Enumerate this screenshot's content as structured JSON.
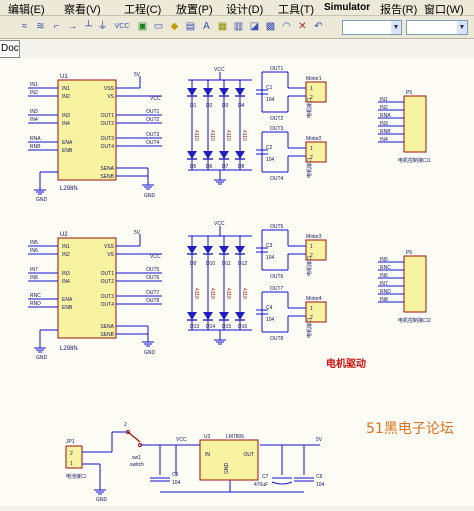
{
  "menu": [
    "编辑(E)",
    "察看(V)",
    "工程(C)",
    "放置(P)",
    "设计(D)",
    "工具(T)",
    "Simulator",
    "报告(R)",
    "窗口(W)"
  ],
  "doc_tab": "Doc",
  "toolbar_icons": [
    "wire-tool-icon",
    "bus-tool-icon",
    "net-label-icon",
    "port-icon",
    "power-port-icon",
    "vcc-icon",
    "ground-icon",
    "part-icon",
    "sheet-icon",
    "junction-icon",
    "no-erc-icon",
    "text-icon",
    "line-icon",
    "cross-icon",
    "undo-icon"
  ],
  "vcc_label": "VCC",
  "colors": {
    "wire": "#1010d0",
    "component": "#a01010",
    "body_fill": "#f8f3a0",
    "text": "#101060",
    "red_text": "#d01010"
  },
  "chips": [
    {
      "ref": "U1",
      "part": "L298N",
      "in": [
        "IN1",
        "IN2",
        "IN3",
        "IN4",
        "ENA",
        "ENB"
      ],
      "pins_left": [
        "5",
        "7",
        "10",
        "12",
        "6",
        "11"
      ],
      "right": [
        "VSS",
        "VS",
        "OUT1",
        "OUT2",
        "OUT3",
        "OUT4",
        "SENA",
        "SENB"
      ],
      "pins_right": [
        "9",
        "4",
        "2",
        "3",
        "13",
        "14",
        "1",
        "15"
      ],
      "gnd_pin": "8"
    },
    {
      "ref": "U2",
      "part": "L298N",
      "in": [
        "IN1",
        "IN2",
        "IN3",
        "IN4",
        "ENA",
        "ENB"
      ],
      "pins_left": [
        "5",
        "7",
        "10",
        "12",
        "6",
        "11"
      ],
      "right": [
        "VSS",
        "VS",
        "OUT1",
        "OUT2",
        "OUT3",
        "OUT4",
        "SENA",
        "SENB"
      ],
      "pins_right": [
        "9",
        "4",
        "2",
        "3",
        "13",
        "14",
        "1",
        "15"
      ],
      "gnd_pin": "8"
    }
  ],
  "chip1_nets_left": [
    "IN1",
    "IN2",
    "IN3",
    "IN4",
    "RNA",
    "RNB"
  ],
  "chip2_nets_left": [
    "IN5",
    "IN6",
    "IN7",
    "IN8",
    "RNC",
    "RND"
  ],
  "chip1_nets_right": [
    "VCC",
    "OUT1",
    "OUT2",
    "OUT3",
    "OUT4"
  ],
  "chip2_nets_right": [
    "VCC",
    "OUT5",
    "OUT6",
    "OUT7",
    "OUT8"
  ],
  "diodes_top": [
    "D1",
    "D2",
    "D3",
    "D4",
    "D5",
    "D6",
    "D7",
    "D8"
  ],
  "diodes_bottom": [
    "D9",
    "D10",
    "D11",
    "D12",
    "D13",
    "D14",
    "D15",
    "D16"
  ],
  "inductor_labels_top": [
    "4110",
    "4110",
    "4110",
    "4110"
  ],
  "inductor_labels_bottom": [
    "4110",
    "4110",
    "4110",
    "4110"
  ],
  "motors": [
    {
      "title": "Motor1",
      "label": "电机接口",
      "caps": [
        "C1",
        "104"
      ],
      "nets": [
        "OUT1",
        "OUT2"
      ]
    },
    {
      "title": "Motor2",
      "label": "电机接口",
      "caps": [
        "C2",
        "104"
      ],
      "nets": [
        "OUT3",
        "OUT4"
      ]
    },
    {
      "title": "Motor3",
      "label": "电机接口",
      "caps": [
        "C3",
        "104"
      ],
      "nets": [
        "OUT5",
        "OUT6"
      ]
    },
    {
      "title": "Motor4",
      "label": "电机接口",
      "caps": [
        "C4",
        "104"
      ],
      "nets": [
        "OUT7",
        "OUT8"
      ]
    }
  ],
  "connectors": [
    {
      "ref": "P5",
      "pins": [
        "IN1",
        "IN2",
        "RNA",
        "IN3",
        "RNB",
        "IN4"
      ],
      "label": "电机控制接口1"
    },
    {
      "ref": "P6",
      "pins": [
        "IN5",
        "RNC",
        "IN6",
        "IN7",
        "RND",
        "IN8"
      ],
      "label": "电机控制接口2"
    }
  ],
  "section_title": "电机驱动",
  "power": {
    "jp": "JP1",
    "jp_label": "电池接口",
    "switch": "sw1",
    "switch_label": "switch",
    "reg": "U3",
    "reg_part": "LM7805",
    "reg_pins": [
      "IN",
      "OUT",
      "GND"
    ],
    "caps": [
      {
        "ref": "C5",
        "val": "104"
      },
      {
        "ref": "C7",
        "val": "470uF"
      },
      {
        "ref": "C6",
        "val": "104"
      }
    ],
    "out": "5V"
  },
  "gnd_label": "GND",
  "watermark": "51黑电子论坛"
}
